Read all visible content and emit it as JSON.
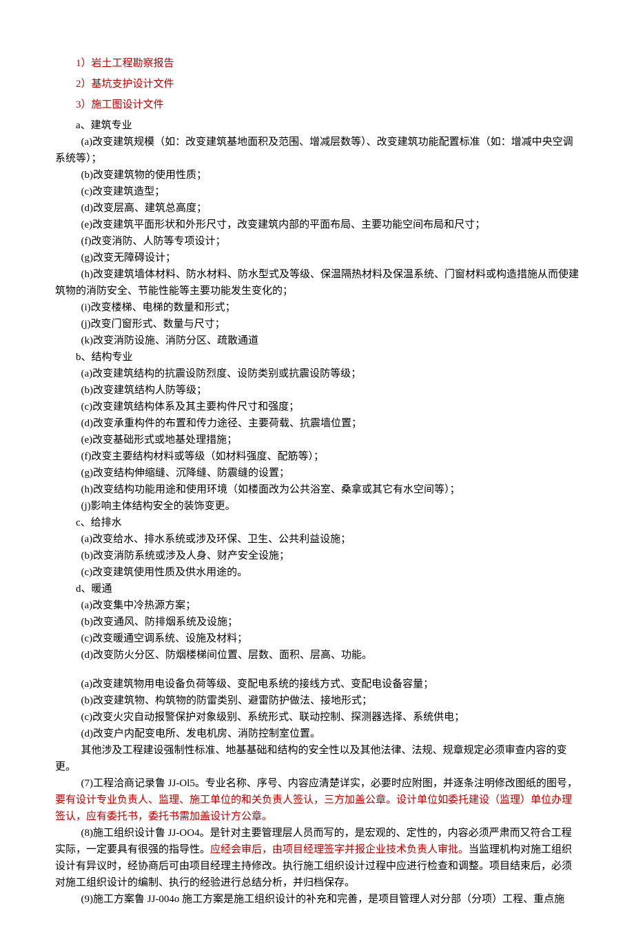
{
  "header_items": [
    {
      "text": "1）岩土工程勘察报告",
      "red": true
    },
    {
      "text": "2）基坑支护设计文件",
      "red": true
    },
    {
      "text": "3）施工图设计文件",
      "red": true
    }
  ],
  "section_a": {
    "title": "a、建筑专业",
    "lead": "(a)改变建筑规模（如：改变建筑基地面积及范围、增减层数等）、改变建筑功能配置标准（如：增减中央空调系统等）；",
    "items": [
      "(b)改变建筑物的使用性质；",
      "(c)改变建筑造型；",
      "(d)改变层高、建筑总高度；",
      "(e)改变建筑平面形状和外形尺寸，改变建筑内部的平面布局、主要功能空间布局和尺寸；",
      "(f)改变消防、人防等专项设计；",
      "(g)改变无障碍设计；",
      "(h)改变建筑墙体材料、防水材料、防水型式及等级、保温隔热材料及保温系统、门窗材料或构造措施从而使建筑物的消防安全、节能性能等主要功能发生变化的；",
      "(i)改变楼梯、电梯的数量和形式；",
      "(j)改变门窗形式、数量与尺寸；",
      "(k)改变消防设施、消防分区、疏散通道"
    ]
  },
  "section_b": {
    "title": "b、结构专业",
    "items": [
      "(a)改变建筑结构的抗震设防烈度、设防类别或抗震设防等级；",
      "(b)改变建筑结构人防等级；",
      "(c)改变建筑结构体系及其主要构件尺寸和强度；",
      "(d)改变承重构件的布置和传力途径、主要荷载、抗震墙位置；",
      "(e)改变基础形式或地基处理措施；",
      "(f)改变主要结构材料或等级（如材料强度、配筋等）；",
      "(g)改变结构伸缩缝、沉降缝、防震缝的设置；",
      "(h)改变结构功能用途和使用环境（如楼面改为公共浴室、桑拿或其它有水空间等）；",
      "(j)影响主体结构安全的装饰变更。"
    ]
  },
  "section_c": {
    "title": "c、给排水",
    "items": [
      "(a)改变给水、排水系统或涉及环保、卫生、公共利益设施；",
      "(b)改变消防系统或涉及人身、财产安全设施；",
      "(c)改变建筑使用性质及供水用途的。"
    ]
  },
  "section_d": {
    "title": "d、暖通",
    "items": [
      "(a)改变集中冷热源方案；",
      "(b)改变通风、防排烟系统及设施；",
      "(c)改变暖通空调系统、设施及材料；",
      "(d)改变防火分区、防烟楼梯间位置、层数、面积、层高、功能。"
    ]
  },
  "section_e": {
    "items": [
      "(a)改变建筑物用电设备负荷等级、变配电系统的接线方式、变配电设备容量；",
      "(b)改变建筑物、构筑物的防雷类别、避雷防护做法、接地形式；",
      "(c)改变火灾自动报警保护对象级别、系统形式、联动控制、探测器选择、系统供电；",
      "(d)改变户内配变电所、发电机房、消防控制室位置。"
    ]
  },
  "other_clause": "其他涉及工程建设强制性标准、地基基础和结构的安全性以及其他法律、法规、规章规定必须审查内容的变更。",
  "p7": {
    "pre": "(7)工程洽商记录鲁 JJ-Ol5。专业名称、序号、内容应清楚详实，必要时应附图，并逐条注明修改图纸的图号，",
    "red": "要有设计专业负责人、监理、施工单位的和关负责人签认，三方加盖公章。设计单位如委托建设（监理）单位办理签认，应有委托书，委托书需加盖设计方公章。"
  },
  "p8": {
    "pre": "(8)施工组织设计鲁 JJ-OO4。是针对主要管理层人员而写的，是宏观的、定性的，内容必须严肃而又符合工程实际，一定要具有很强的指导性。",
    "red": "应经会审后，由项目经理签字并报企业技术负责人审批。",
    "post": "当监理机构对施工组织设计有异议时，经协商后可由项目经理主持修改。执行施工组织设计过程中应进行检查和调整。项目结束后，必须对施工组织设计的编制、执行的经验进行总结分析，并归档保存。"
  },
  "p9": "(9)施工方案鲁 JJ-004o 施工方案是施工组织设计的补充和完善，是项目管理人对分部（分项）工程、重点施"
}
